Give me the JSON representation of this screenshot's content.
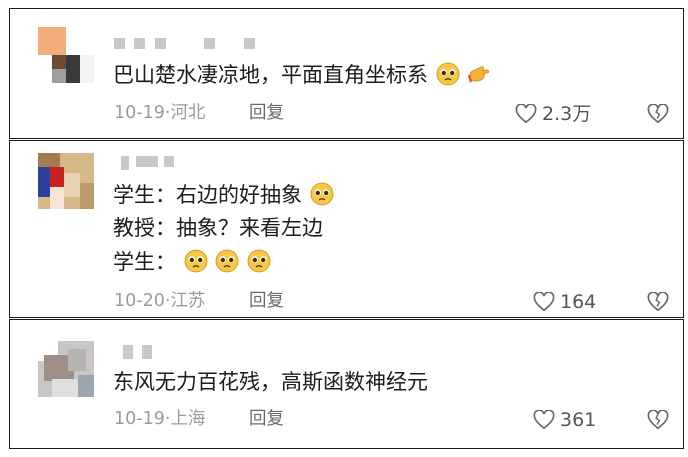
{
  "comments": [
    {
      "text_lines": [
        "巴山楚水凄凉地，平面直角坐标系"
      ],
      "emojis": [
        "pleading-face-emoji",
        "pointing-hand-emoji"
      ],
      "date": "10-19",
      "location": "河北",
      "reply_label": "回复",
      "likes": "2.3万"
    },
    {
      "text_lines": [
        "学生：右边的好抽象",
        "教授：抽象？来看左边",
        "学生："
      ],
      "emojis": [
        "pleading-face-emoji"
      ],
      "date": "10-20",
      "location": "江苏",
      "reply_label": "回复",
      "likes": "164"
    },
    {
      "text_lines": [
        "东风无力百花残，高斯函数神经元"
      ],
      "emojis": [],
      "date": "10-19",
      "location": "上海",
      "reply_label": "回复",
      "likes": "361"
    }
  ],
  "meta_separator": "·",
  "colors": {
    "text": "#1c1c1c",
    "meta": "#9b9b9b",
    "border": "#1a1a1a",
    "emoji_face": "#f6c843"
  },
  "icons": [
    "heart-outline-icon",
    "dislike-heart-icon"
  ]
}
